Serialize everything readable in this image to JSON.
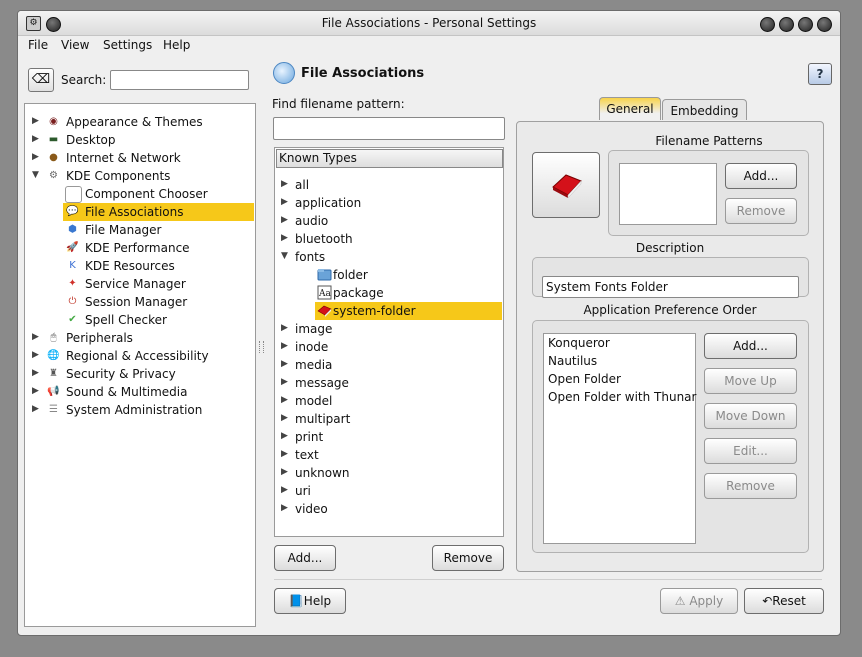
{
  "window": {
    "title": "File Associations - Personal Settings"
  },
  "menu": [
    "File",
    "View",
    "Settings",
    "Help"
  ],
  "search": {
    "label": "Search:",
    "value": ""
  },
  "nav": [
    {
      "label": "Appearance & Themes",
      "expanded": false,
      "indent": 0,
      "icon": "appearance-icon",
      "sel": false
    },
    {
      "label": "Desktop",
      "expanded": false,
      "indent": 0,
      "icon": "desktop-icon",
      "sel": false
    },
    {
      "label": "Internet & Network",
      "expanded": false,
      "indent": 0,
      "icon": "network-icon",
      "sel": false
    },
    {
      "label": "KDE Components",
      "expanded": true,
      "indent": 0,
      "icon": "kde-components-icon",
      "sel": false
    },
    {
      "label": "Component Chooser",
      "indent": 1,
      "icon": "component-chooser-icon",
      "sel": false
    },
    {
      "label": "File Associations",
      "indent": 1,
      "icon": "file-associations-icon",
      "sel": true
    },
    {
      "label": "File Manager",
      "indent": 1,
      "icon": "file-manager-icon",
      "sel": false
    },
    {
      "label": "KDE Performance",
      "indent": 1,
      "icon": "performance-icon",
      "sel": false
    },
    {
      "label": "KDE Resources",
      "indent": 1,
      "icon": "resources-icon",
      "sel": false
    },
    {
      "label": "Service Manager",
      "indent": 1,
      "icon": "service-manager-icon",
      "sel": false
    },
    {
      "label": "Session Manager",
      "indent": 1,
      "icon": "session-manager-icon",
      "sel": false
    },
    {
      "label": "Spell Checker",
      "indent": 1,
      "icon": "spell-checker-icon",
      "sel": false
    },
    {
      "label": "Peripherals",
      "expanded": false,
      "indent": 0,
      "icon": "peripherals-icon",
      "sel": false
    },
    {
      "label": "Regional & Accessibility",
      "expanded": false,
      "indent": 0,
      "icon": "regional-icon",
      "sel": false
    },
    {
      "label": "Security & Privacy",
      "expanded": false,
      "indent": 0,
      "icon": "security-icon",
      "sel": false
    },
    {
      "label": "Sound & Multimedia",
      "expanded": false,
      "indent": 0,
      "icon": "sound-icon",
      "sel": false
    },
    {
      "label": "System Administration",
      "expanded": false,
      "indent": 0,
      "icon": "system-admin-icon",
      "sel": false
    }
  ],
  "header": {
    "title": "File Associations",
    "help": "?"
  },
  "find": {
    "label": "Find filename pattern:",
    "value": ""
  },
  "types": {
    "header": "Known Types",
    "rows": [
      {
        "label": "all",
        "kind": "group",
        "exp": false
      },
      {
        "label": "application",
        "kind": "group",
        "exp": false
      },
      {
        "label": "audio",
        "kind": "group",
        "exp": false
      },
      {
        "label": "bluetooth",
        "kind": "group",
        "exp": false
      },
      {
        "label": "fonts",
        "kind": "group",
        "exp": true
      },
      {
        "label": "folder",
        "kind": "child",
        "icon": "folder-icon"
      },
      {
        "label": "package",
        "kind": "child",
        "icon": "font-package-icon"
      },
      {
        "label": "system-folder",
        "kind": "child",
        "icon": "system-folder-icon",
        "sel": true
      },
      {
        "label": "image",
        "kind": "group",
        "exp": false
      },
      {
        "label": "inode",
        "kind": "group",
        "exp": false
      },
      {
        "label": "media",
        "kind": "group",
        "exp": false
      },
      {
        "label": "message",
        "kind": "group",
        "exp": false
      },
      {
        "label": "model",
        "kind": "group",
        "exp": false
      },
      {
        "label": "multipart",
        "kind": "group",
        "exp": false
      },
      {
        "label": "print",
        "kind": "group",
        "exp": false
      },
      {
        "label": "text",
        "kind": "group",
        "exp": false
      },
      {
        "label": "unknown",
        "kind": "group",
        "exp": false
      },
      {
        "label": "uri",
        "kind": "group",
        "exp": false
      },
      {
        "label": "video",
        "kind": "group",
        "exp": false
      }
    ],
    "add": "Add...",
    "remove": "Remove"
  },
  "tabs": [
    "General",
    "Embedding"
  ],
  "general": {
    "patterns_label": "Filename Patterns",
    "add": "Add...",
    "remove": "Remove",
    "description_label": "Description",
    "description": "System Fonts Folder",
    "apps_label": "Application Preference Order",
    "apps": [
      "Konqueror",
      "Nautilus",
      "Open Folder",
      "Open Folder with Thunar"
    ],
    "app_add": "Add...",
    "move_up": "Move Up",
    "move_down": "Move Down",
    "edit": "Edit...",
    "app_remove": "Remove"
  },
  "bottom": {
    "help": "Help",
    "apply": "Apply",
    "reset": "Reset"
  },
  "colors": {
    "selection": "#f6c819",
    "window": "#efefef"
  }
}
